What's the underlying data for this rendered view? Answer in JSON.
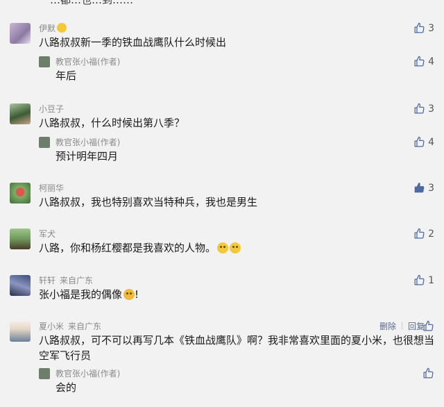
{
  "top_fragment": "…都…也…到……",
  "comments": [
    {
      "nick": "伊默",
      "text": "八路叔叔新一季的铁血战鹰队什么时候出",
      "likes": "3",
      "reply": {
        "author": "教官张小福(作者)",
        "text": "年后",
        "likes": "4"
      }
    },
    {
      "nick": "小豆子",
      "text": "八路叔叔，什么时候出第八季？",
      "likes": "3",
      "reply": {
        "author": "教官张小福(作者)",
        "text": "预计明年四月",
        "likes": "4"
      }
    },
    {
      "nick": "柯丽华",
      "text": "八路叔叔，我也特别喜欢当特种兵，我也是男生",
      "likes": "3"
    },
    {
      "nick": "军犬",
      "text": "八路，你和杨红樱都是我喜欢的人物。",
      "likes": "2"
    },
    {
      "nick": "轩轩",
      "location": "来自广东",
      "text": "张小福是我的偶像",
      "text_suffix": "!",
      "likes": "1"
    },
    {
      "nick": "夏小米",
      "location": "来自广东",
      "text": "八路叔叔，可不可以再写几本《铁血战鹰队》啊？我非常喜欢里面的夏小米，也很想当空军飞行员",
      "delete_label": "删除",
      "reply_label": "回复",
      "reply": {
        "author": "教官张小福(作者)",
        "text": "会的"
      }
    }
  ],
  "colors": {
    "background": "#f2f2f2",
    "nick": "#8a8a8a",
    "action": "#5b6b8c",
    "liked": "#4e6aa0"
  },
  "icons": {
    "like": "thumbs-up-outline-icon",
    "liked": "thumbs-up-filled-icon"
  }
}
